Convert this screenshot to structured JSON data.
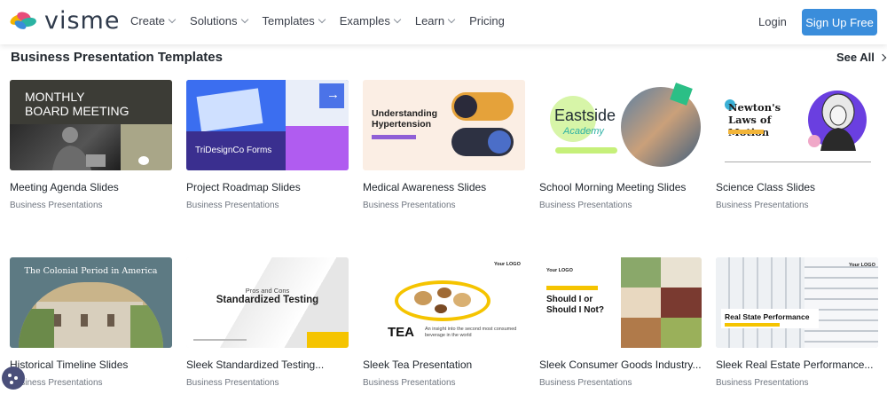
{
  "header": {
    "logo_text": "visme",
    "nav": [
      {
        "label": "Create",
        "dropdown": true
      },
      {
        "label": "Solutions",
        "dropdown": true
      },
      {
        "label": "Templates",
        "dropdown": true
      },
      {
        "label": "Examples",
        "dropdown": true
      },
      {
        "label": "Learn",
        "dropdown": true
      },
      {
        "label": "Pricing",
        "dropdown": false
      }
    ],
    "login_label": "Login",
    "signup_label": "Sign Up Free"
  },
  "section": {
    "title": "Business Presentation Templates",
    "see_all_label": "See All"
  },
  "cards": [
    {
      "title": "Meeting Agenda Slides",
      "category": "Business Presentations",
      "thumb": {
        "heading": "MONTHLY\nBOARD MEETING"
      }
    },
    {
      "title": "Project Roadmap Slides",
      "category": "Business Presentations",
      "thumb": {
        "heading": "TriDesignCo Forms"
      }
    },
    {
      "title": "Medical Awareness Slides",
      "category": "Business Presentations",
      "thumb": {
        "heading": "Understanding Hypertension"
      }
    },
    {
      "title": "School Morning Meeting Slides",
      "category": "Business Presentations",
      "thumb": {
        "heading": "Eastside",
        "subheading": "Academy"
      }
    },
    {
      "title": "Science Class Slides",
      "category": "Business Presentations",
      "thumb": {
        "heading": "Newton's Laws of Motion"
      }
    },
    {
      "title": "Historical Timeline Slides",
      "category": "Business Presentations",
      "thumb": {
        "heading": "The Colonial Period in America"
      }
    },
    {
      "title": "Sleek Standardized Testing...",
      "category": "Business Presentations",
      "thumb": {
        "subheading": "Pros and Cons",
        "heading": "Standardized Testing"
      }
    },
    {
      "title": "Sleek Tea Presentation",
      "category": "Business Presentations",
      "thumb": {
        "heading": "TEA",
        "caption": "An insight into the second most consumed beverage in the world",
        "logo": "Your LOGO"
      }
    },
    {
      "title": "Sleek Consumer Goods Industry...",
      "category": "Business Presentations",
      "thumb": {
        "heading": "Should I or Should I Not?",
        "logo": "Your LOGO"
      }
    },
    {
      "title": "Sleek Real Estate Performance...",
      "category": "Business Presentations",
      "thumb": {
        "heading": "Real State Performance",
        "logo": "Your LOGO"
      }
    }
  ],
  "colors": {
    "accent": "#3a8ddb",
    "text": "#22282f"
  }
}
